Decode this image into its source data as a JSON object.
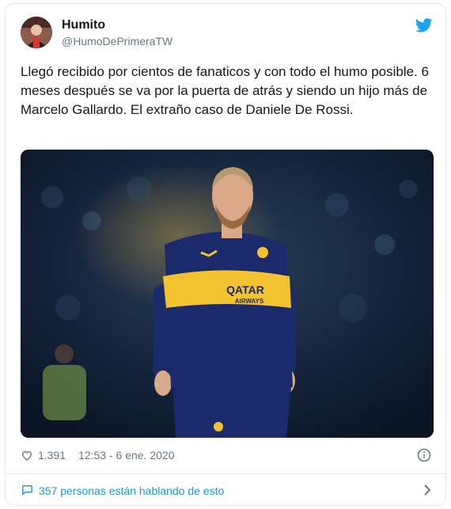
{
  "user": {
    "name": "Humito",
    "handle": "@HumoDePrimeraTW"
  },
  "tweet": {
    "text": "Llegó recibido por cientos de fanaticos y con todo el humo posible. 6 meses después se va por la puerta de atrás y siendo un hijo más de Marcelo Gallardo. El extraño caso de Daniele De Rossi.",
    "likes": "1.391",
    "timestamp": "12:53 - 6 ene. 2020"
  },
  "conversation": {
    "label": "357 personas están hablando de esto"
  },
  "media": {
    "shirt_sponsor": "QATAR AIRWAYS"
  },
  "colors": {
    "accent": "#1da1f2",
    "link": "#1b95e0",
    "secondary_text": "#657786",
    "border": "#e1e8ed",
    "jersey_blue": "#1b2a6b",
    "jersey_yellow": "#f2c230"
  },
  "icons": {
    "brand": "twitter-bird-icon",
    "like": "heart-icon",
    "info": "info-icon",
    "talk": "speech-bubble-icon",
    "more": "chevron-right-icon"
  }
}
